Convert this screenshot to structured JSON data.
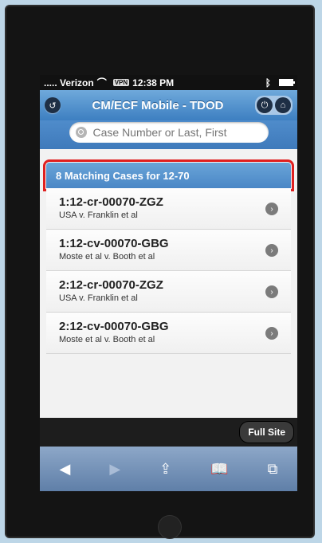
{
  "status": {
    "carrier": "..... Verizon",
    "vpn": "VPN",
    "time": "12:38 PM"
  },
  "header": {
    "title": "CM/ECF Mobile - TDOD"
  },
  "search": {
    "placeholder": "Case Number or Last, First"
  },
  "list": {
    "header": "8 Matching Cases for 12-70",
    "items": [
      {
        "case": "1:12-cr-00070-ZGZ",
        "parties": "USA v. Franklin et al"
      },
      {
        "case": "1:12-cv-00070-GBG",
        "parties": "Moste et al v. Booth et al"
      },
      {
        "case": "2:12-cr-00070-ZGZ",
        "parties": "USA v. Franklin et al"
      },
      {
        "case": "2:12-cv-00070-GBG",
        "parties": "Moste et al v. Booth et al"
      }
    ]
  },
  "footer": {
    "full_site": "Full Site"
  },
  "icons": {
    "back": "back-icon",
    "power": "power-icon",
    "home": "home-icon",
    "chevron": "chevron-right-icon"
  },
  "colors": {
    "highlight": "#e02020",
    "header_blue": "#4a87c6"
  }
}
